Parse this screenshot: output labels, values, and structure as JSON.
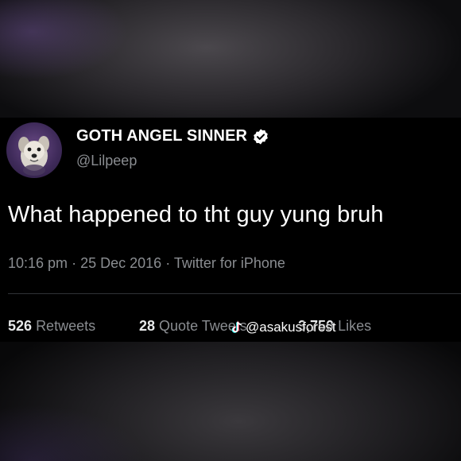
{
  "tweet": {
    "display_name": "GOTH ANGEL SINNER",
    "handle": "@Lilpeep",
    "text": "What happened to tht guy yung bruh",
    "time": "10:16 pm",
    "date": "25 Dec 2016",
    "source": "Twitter for iPhone",
    "separator": "·",
    "stats": {
      "retweets_count": "526",
      "retweets_label": "Retweets",
      "quotes_count": "28",
      "quotes_label": "Quote Tweets",
      "likes_count": "3,750",
      "likes_label": "Likes"
    }
  },
  "watermark": {
    "text": "@asakusforest",
    "icon": "tiktok-icon"
  },
  "colors": {
    "background": "#000000",
    "text_primary": "#ffffff",
    "text_secondary": "#8a8d91",
    "divider": "#2f3336"
  }
}
